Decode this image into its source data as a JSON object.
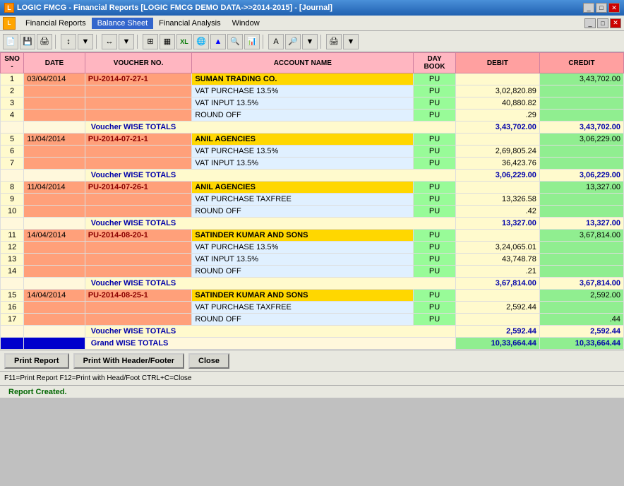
{
  "window": {
    "title": "LOGIC FMCG - Financial Reports  [LOGIC FMCG DEMO DATA->>2014-2015] - [Journal]",
    "title_icon": "L",
    "menu": {
      "items": [
        {
          "label": "Financial Reports",
          "active": false
        },
        {
          "label": "Balance Sheet",
          "active": true
        },
        {
          "label": "Financial Analysis",
          "active": false
        },
        {
          "label": "Window",
          "active": false
        }
      ]
    }
  },
  "table": {
    "headers": [
      "SNO",
      "DATE",
      "VOUCHER NO.",
      "ACCOUNT NAME",
      "DAY BOOK",
      "DEBIT",
      "CREDIT"
    ],
    "rows": [
      {
        "sno": "1",
        "date": "03/04/2014",
        "voucher": "PU-2014-07-27-1",
        "account": "SUMAN TRADING CO.",
        "daybook": "PU",
        "debit": "",
        "credit": "3,43,702.00",
        "type": "main"
      },
      {
        "sno": "2",
        "date": "",
        "voucher": "",
        "account": "VAT PURCHASE 13.5%",
        "daybook": "PU",
        "debit": "3,02,820.89",
        "credit": "",
        "type": "sub"
      },
      {
        "sno": "3",
        "date": "",
        "voucher": "",
        "account": "VAT INPUT 13.5%",
        "daybook": "PU",
        "debit": "40,880.82",
        "credit": "",
        "type": "sub"
      },
      {
        "sno": "4",
        "date": "",
        "voucher": "",
        "account": "ROUND OFF",
        "daybook": "PU",
        "debit": ".29",
        "credit": "",
        "type": "sub"
      },
      {
        "sno": "",
        "date": "",
        "voucher": "Voucher WISE TOTALS",
        "account": "",
        "daybook": "",
        "debit": "3,43,702.00",
        "credit": "3,43,702.00",
        "type": "total"
      },
      {
        "sno": "5",
        "date": "11/04/2014",
        "voucher": "PU-2014-07-21-1",
        "account": "ANIL AGENCIES",
        "daybook": "PU",
        "debit": "",
        "credit": "3,06,229.00",
        "type": "main"
      },
      {
        "sno": "6",
        "date": "",
        "voucher": "",
        "account": "VAT PURCHASE 13.5%",
        "daybook": "PU",
        "debit": "2,69,805.24",
        "credit": "",
        "type": "sub"
      },
      {
        "sno": "7",
        "date": "",
        "voucher": "",
        "account": "VAT INPUT 13.5%",
        "daybook": "PU",
        "debit": "36,423.76",
        "credit": "",
        "type": "sub"
      },
      {
        "sno": "",
        "date": "",
        "voucher": "Voucher WISE TOTALS",
        "account": "",
        "daybook": "",
        "debit": "3,06,229.00",
        "credit": "3,06,229.00",
        "type": "total"
      },
      {
        "sno": "8",
        "date": "11/04/2014",
        "voucher": "PU-2014-07-26-1",
        "account": "ANIL AGENCIES",
        "daybook": "PU",
        "debit": "",
        "credit": "13,327.00",
        "type": "main"
      },
      {
        "sno": "9",
        "date": "",
        "voucher": "",
        "account": "VAT PURCHASE TAXFREE",
        "daybook": "PU",
        "debit": "13,326.58",
        "credit": "",
        "type": "sub"
      },
      {
        "sno": "10",
        "date": "",
        "voucher": "",
        "account": "ROUND OFF",
        "daybook": "PU",
        "debit": ".42",
        "credit": "",
        "type": "sub"
      },
      {
        "sno": "",
        "date": "",
        "voucher": "Voucher WISE TOTALS",
        "account": "",
        "daybook": "",
        "debit": "13,327.00",
        "credit": "13,327.00",
        "type": "total"
      },
      {
        "sno": "11",
        "date": "14/04/2014",
        "voucher": "PU-2014-08-20-1",
        "account": "SATINDER KUMAR AND SONS",
        "daybook": "PU",
        "debit": "",
        "credit": "3,67,814.00",
        "type": "main"
      },
      {
        "sno": "12",
        "date": "",
        "voucher": "",
        "account": "VAT PURCHASE 13.5%",
        "daybook": "PU",
        "debit": "3,24,065.01",
        "credit": "",
        "type": "sub"
      },
      {
        "sno": "13",
        "date": "",
        "voucher": "",
        "account": "VAT INPUT 13.5%",
        "daybook": "PU",
        "debit": "43,748.78",
        "credit": "",
        "type": "sub"
      },
      {
        "sno": "14",
        "date": "",
        "voucher": "",
        "account": "ROUND OFF",
        "daybook": "PU",
        "debit": ".21",
        "credit": "",
        "type": "sub"
      },
      {
        "sno": "",
        "date": "",
        "voucher": "Voucher WISE TOTALS",
        "account": "",
        "daybook": "",
        "debit": "3,67,814.00",
        "credit": "3,67,814.00",
        "type": "total"
      },
      {
        "sno": "15",
        "date": "14/04/2014",
        "voucher": "PU-2014-08-25-1",
        "account": "SATINDER KUMAR AND SONS",
        "daybook": "PU",
        "debit": "",
        "credit": "2,592.00",
        "type": "main"
      },
      {
        "sno": "16",
        "date": "",
        "voucher": "",
        "account": "VAT PURCHASE TAXFREE",
        "daybook": "PU",
        "debit": "2,592.44",
        "credit": "",
        "type": "sub"
      },
      {
        "sno": "17",
        "date": "",
        "voucher": "",
        "account": "ROUND OFF",
        "daybook": "PU",
        "debit": "",
        "credit": ".44",
        "type": "sub"
      },
      {
        "sno": "",
        "date": "",
        "voucher": "Voucher WISE TOTALS",
        "account": "",
        "daybook": "",
        "debit": "2,592.44",
        "credit": "2,592.44",
        "type": "total"
      },
      {
        "sno": "",
        "date": "",
        "voucher": "Grand WISE TOTALS",
        "account": "",
        "daybook": "",
        "debit": "10,33,664.44",
        "credit": "10,33,664.44",
        "type": "grand"
      }
    ]
  },
  "buttons": {
    "print_report": "Print Report",
    "print_with_header": "Print With Header/Footer",
    "close": "Close"
  },
  "status": {
    "shortcuts": "F11=Print Report  F12=Print with Head/Foot  CTRL+C=Close",
    "message": "Report Created."
  },
  "colors": {
    "accent": "#3366cc",
    "header_bg": "#ffb6c1",
    "date_bg": "#ffa07a",
    "account_bg": "#e0f0ff",
    "daybook_bg": "#98fb98",
    "debit_bg": "#fffacd",
    "credit_bg": "#90ee90",
    "total_color": "#0000aa"
  }
}
